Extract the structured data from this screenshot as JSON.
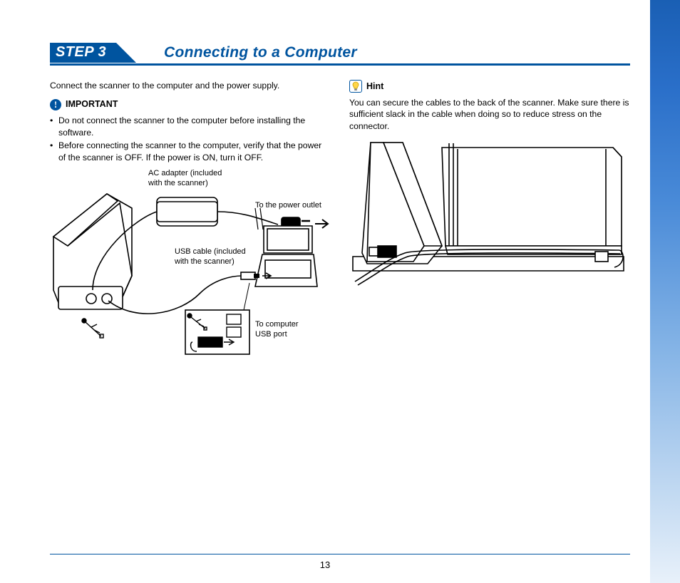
{
  "step": {
    "label": "STEP 3",
    "title": "Connecting to a Computer"
  },
  "page_number": "13",
  "left": {
    "intro": "Connect the scanner to the computer and the power supply.",
    "important_label": "IMPORTANT",
    "bullets": [
      "Do not connect the scanner to the computer before installing the software.",
      "Before connecting the scanner to the computer, verify that the power of the scanner is OFF. If the power is ON, turn it OFF."
    ],
    "fig_labels": {
      "ac_adapter_1": "AC adapter (included",
      "ac_adapter_2": "with the scanner)",
      "to_power": "To the power outlet",
      "usb_cable_1": "USB cable (included",
      "usb_cable_2": "with the scanner)",
      "to_usb_1": "To computer",
      "to_usb_2": "USB port"
    }
  },
  "right": {
    "hint_label": "Hint",
    "hint_text": "You can secure the cables to the back of the scanner. Make sure there is sufficient slack in the cable when doing so to reduce stress on the connector."
  }
}
